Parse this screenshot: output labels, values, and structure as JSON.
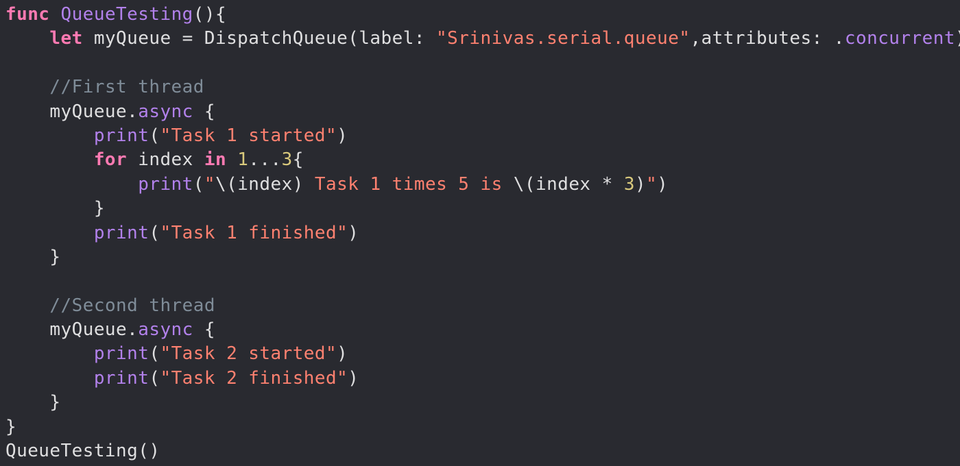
{
  "editor": {
    "colors": {
      "background": "#292a30",
      "keyword": "#ff7ab2",
      "function": "#b281eb",
      "string": "#ff8170",
      "number": "#d9c97c",
      "comment": "#7f8c98",
      "plain": "#dfdfe0"
    },
    "lines": [
      [
        {
          "text": "func",
          "type": "keyword"
        },
        {
          "text": " ",
          "type": "plain"
        },
        {
          "text": "QueueTesting",
          "type": "fn"
        },
        {
          "text": "(){",
          "type": "plain"
        }
      ],
      [
        {
          "text": "    ",
          "type": "plain"
        },
        {
          "text": "let",
          "type": "keyword"
        },
        {
          "text": " myQueue = DispatchQueue(label: ",
          "type": "plain"
        },
        {
          "text": "\"Srinivas.serial.queue\"",
          "type": "string"
        },
        {
          "text": ",attributes: .",
          "type": "plain"
        },
        {
          "text": "concurrent",
          "type": "fn"
        },
        {
          "text": ")",
          "type": "plain"
        }
      ],
      [],
      [
        {
          "text": "    ",
          "type": "plain"
        },
        {
          "text": "//First thread",
          "type": "comment"
        }
      ],
      [
        {
          "text": "    myQueue.",
          "type": "plain"
        },
        {
          "text": "async",
          "type": "fn"
        },
        {
          "text": " {",
          "type": "plain"
        }
      ],
      [
        {
          "text": "        ",
          "type": "plain"
        },
        {
          "text": "print",
          "type": "fn"
        },
        {
          "text": "(",
          "type": "plain"
        },
        {
          "text": "\"Task 1 started\"",
          "type": "string"
        },
        {
          "text": ")",
          "type": "plain"
        }
      ],
      [
        {
          "text": "        ",
          "type": "plain"
        },
        {
          "text": "for",
          "type": "keyword"
        },
        {
          "text": " index ",
          "type": "plain"
        },
        {
          "text": "in",
          "type": "keyword"
        },
        {
          "text": " ",
          "type": "plain"
        },
        {
          "text": "1",
          "type": "number"
        },
        {
          "text": "...",
          "type": "plain"
        },
        {
          "text": "3",
          "type": "number"
        },
        {
          "text": "{",
          "type": "plain"
        }
      ],
      [
        {
          "text": "            ",
          "type": "plain"
        },
        {
          "text": "print",
          "type": "fn"
        },
        {
          "text": "(",
          "type": "plain"
        },
        {
          "text": "\"",
          "type": "string"
        },
        {
          "text": "\\(index)",
          "type": "plain"
        },
        {
          "text": " Task 1 times 5 is ",
          "type": "string"
        },
        {
          "text": "\\(index * ",
          "type": "plain"
        },
        {
          "text": "3",
          "type": "number"
        },
        {
          "text": ")",
          "type": "plain"
        },
        {
          "text": "\"",
          "type": "string"
        },
        {
          "text": ")",
          "type": "plain"
        }
      ],
      [
        {
          "text": "        }",
          "type": "plain"
        }
      ],
      [
        {
          "text": "        ",
          "type": "plain"
        },
        {
          "text": "print",
          "type": "fn"
        },
        {
          "text": "(",
          "type": "plain"
        },
        {
          "text": "\"Task 1 finished\"",
          "type": "string"
        },
        {
          "text": ")",
          "type": "plain"
        }
      ],
      [
        {
          "text": "    }",
          "type": "plain"
        }
      ],
      [],
      [
        {
          "text": "    ",
          "type": "plain"
        },
        {
          "text": "//Second thread",
          "type": "comment"
        }
      ],
      [
        {
          "text": "    myQueue.",
          "type": "plain"
        },
        {
          "text": "async",
          "type": "fn"
        },
        {
          "text": " {",
          "type": "plain"
        }
      ],
      [
        {
          "text": "        ",
          "type": "plain"
        },
        {
          "text": "print",
          "type": "fn"
        },
        {
          "text": "(",
          "type": "plain"
        },
        {
          "text": "\"Task 2 started\"",
          "type": "string"
        },
        {
          "text": ")",
          "type": "plain"
        }
      ],
      [
        {
          "text": "        ",
          "type": "plain"
        },
        {
          "text": "print",
          "type": "fn"
        },
        {
          "text": "(",
          "type": "plain"
        },
        {
          "text": "\"Task 2 finished\"",
          "type": "string"
        },
        {
          "text": ")",
          "type": "plain"
        }
      ],
      [
        {
          "text": "    }",
          "type": "plain"
        }
      ],
      [
        {
          "text": "}",
          "type": "plain"
        }
      ],
      [
        {
          "text": "QueueTesting()",
          "type": "plain"
        }
      ]
    ]
  }
}
